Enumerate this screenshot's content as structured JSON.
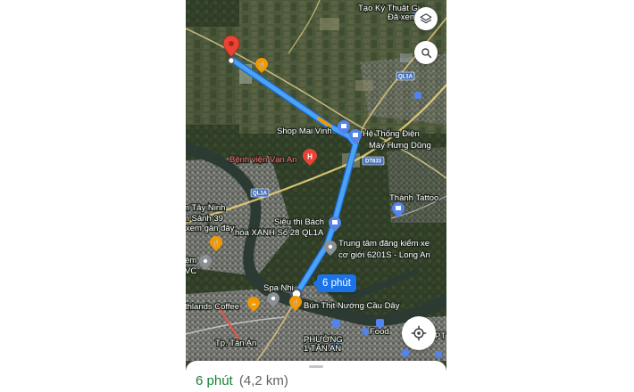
{
  "map": {
    "place_labels": {
      "tao_ky": "Tạo Ký Thuật Gi...",
      "da_xem": "Đã xem",
      "shop_mai_vinh": "Shop Mai Vinh",
      "he_thong_1": "Hệ Thống Điện",
      "he_thong_2": "Máy Hưng Dũng",
      "benh_vien": "Bệnh viện Vạn An",
      "thanh_tattoo": "Thành Tattoo",
      "tay_ninh": "m Tây Ninh",
      "sanh_39": "m Sảnh 39",
      "xem_gan_day": "xem gần đây",
      "sieu_thi_1": "Siêu thị Bách",
      "sieu_thi_2": "hóa XANH Số 28 QL1A",
      "trung_tam_1": "Trung tâm đăng kiểm xe",
      "trung_tam_2": "cơ giới 6201S - Long An",
      "em": "ẻm",
      "vc": "VC",
      "spa_nhi": "Spa Nhi",
      "thlands_coffee": "thlands Coffee",
      "bun_thit": "Bún Thịt Nướng Cầu Dây",
      "tp_tan_an": "Tp. Tân An",
      "phuong_1": "PHƯỜNG",
      "phuong_2": "1 TÂN AN",
      "food": "Food",
      "pt": "PT"
    },
    "road_labels": {
      "ql1a_top": "QL1A",
      "dt833": "DT833",
      "ql1a_left": "QL1A"
    },
    "route_time": "6 phút"
  },
  "controls": {
    "layers_icon": "layers-icon",
    "search_icon": "search-icon",
    "locate_icon": "my-location-icon"
  },
  "bottom_sheet": {
    "time": "6 phút",
    "distance": "(4,2 km)"
  },
  "colors": {
    "route": "#4aa3f5",
    "route_casing": "#1967d2",
    "eta_green": "#188038",
    "pin_red": "#ea4335",
    "food_orange": "#f29900",
    "shop_blue": "#5383ec"
  }
}
